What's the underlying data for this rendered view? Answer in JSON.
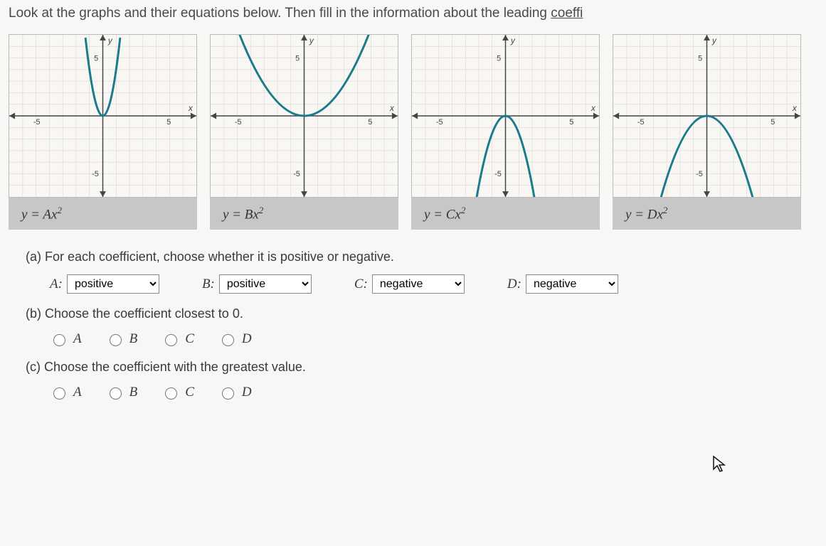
{
  "instruction": {
    "text": "Look at the graphs and their equations below. Then fill in the information about the leading ",
    "underlined_word": "coeffi"
  },
  "graphs": [
    {
      "equation_lhs": "y = Ax",
      "equation_sup": "2",
      "axis": {
        "xmin": -5,
        "xmax": 5,
        "ymin": -5,
        "ymax": 5,
        "xlabel": "x",
        "ylabel": "y"
      }
    },
    {
      "equation_lhs": "y = Bx",
      "equation_sup": "2",
      "axis": {
        "xmin": -5,
        "xmax": 5,
        "ymin": -5,
        "ymax": 5,
        "xlabel": "x",
        "ylabel": "y"
      }
    },
    {
      "equation_lhs": "y = Cx",
      "equation_sup": "2",
      "axis": {
        "xmin": -5,
        "xmax": 5,
        "ymin": -5,
        "ymax": 5,
        "xlabel": "x",
        "ylabel": "y"
      }
    },
    {
      "equation_lhs": "y = Dx",
      "equation_sup": "2",
      "axis": {
        "xmin": -5,
        "xmax": 5,
        "ymin": -5,
        "ymax": 5,
        "xlabel": "x",
        "ylabel": "y"
      }
    }
  ],
  "chart_data": [
    {
      "type": "line",
      "title": "y = Ax^2",
      "xlabel": "x",
      "ylabel": "y",
      "xlim": [
        -7,
        7
      ],
      "ylim": [
        -7,
        7
      ],
      "series": [
        {
          "name": "A",
          "coefficient_sign": "positive",
          "coefficient_approx": 4,
          "points": [
            [
              -1.3,
              6.76
            ],
            [
              -1.2,
              5.76
            ],
            [
              -1,
              4
            ],
            [
              -0.8,
              2.56
            ],
            [
              -0.6,
              1.44
            ],
            [
              -0.4,
              0.64
            ],
            [
              -0.2,
              0.16
            ],
            [
              0,
              0
            ],
            [
              0.2,
              0.16
            ],
            [
              0.4,
              0.64
            ],
            [
              0.6,
              1.44
            ],
            [
              0.8,
              2.56
            ],
            [
              1,
              4
            ],
            [
              1.2,
              5.76
            ],
            [
              1.3,
              6.76
            ]
          ]
        }
      ]
    },
    {
      "type": "line",
      "title": "y = Bx^2",
      "xlabel": "x",
      "ylabel": "y",
      "xlim": [
        -7,
        7
      ],
      "ylim": [
        -7,
        7
      ],
      "series": [
        {
          "name": "B",
          "coefficient_sign": "positive",
          "coefficient_approx": 0.3,
          "points": [
            [
              -5,
              7.5
            ],
            [
              -4,
              4.8
            ],
            [
              -3,
              2.7
            ],
            [
              -2,
              1.2
            ],
            [
              -1,
              0.3
            ],
            [
              0,
              0
            ],
            [
              1,
              0.3
            ],
            [
              2,
              1.2
            ],
            [
              3,
              2.7
            ],
            [
              4,
              4.8
            ],
            [
              5,
              7.5
            ]
          ]
        }
      ]
    },
    {
      "type": "line",
      "title": "y = Cx^2",
      "xlabel": "x",
      "ylabel": "y",
      "xlim": [
        -7,
        7
      ],
      "ylim": [
        -7,
        7
      ],
      "series": [
        {
          "name": "C",
          "coefficient_sign": "negative",
          "coefficient_approx": -1.5,
          "points": [
            [
              -2.2,
              -7.26
            ],
            [
              -2,
              -6
            ],
            [
              -1.5,
              -3.375
            ],
            [
              -1,
              -1.5
            ],
            [
              -0.5,
              -0.375
            ],
            [
              0,
              0
            ],
            [
              0.5,
              -0.375
            ],
            [
              1,
              -1.5
            ],
            [
              1.5,
              -3.375
            ],
            [
              2,
              -6
            ],
            [
              2.2,
              -7.26
            ]
          ]
        }
      ]
    },
    {
      "type": "line",
      "title": "y = Dx^2",
      "xlabel": "x",
      "ylabel": "y",
      "xlim": [
        -7,
        7
      ],
      "ylim": [
        -7,
        7
      ],
      "series": [
        {
          "name": "D",
          "coefficient_sign": "negative",
          "coefficient_approx": -0.6,
          "points": [
            [
              -3.5,
              -7.35
            ],
            [
              -3,
              -5.4
            ],
            [
              -2.5,
              -3.75
            ],
            [
              -2,
              -2.4
            ],
            [
              -1.5,
              -1.35
            ],
            [
              -1,
              -0.6
            ],
            [
              -0.5,
              -0.15
            ],
            [
              0,
              0
            ],
            [
              0.5,
              -0.15
            ],
            [
              1,
              -0.6
            ],
            [
              1.5,
              -1.35
            ],
            [
              2,
              -2.4
            ],
            [
              2.5,
              -3.75
            ],
            [
              3,
              -5.4
            ],
            [
              3.5,
              -7.35
            ]
          ]
        }
      ]
    }
  ],
  "part_a": {
    "prompt": "(a)  For each coefficient, choose whether it is positive or negative.",
    "options": [
      "positive",
      "negative"
    ],
    "items": [
      {
        "label": "A:",
        "selected": "positive"
      },
      {
        "label": "B:",
        "selected": "positive"
      },
      {
        "label": "C:",
        "selected": "negative"
      },
      {
        "label": "D:",
        "selected": "negative"
      }
    ]
  },
  "part_b": {
    "prompt": "(b)  Choose the coefficient closest to 0.",
    "choices": [
      "A",
      "B",
      "C",
      "D"
    ]
  },
  "part_c": {
    "prompt": "(c)  Choose the coefficient with the greatest value.",
    "choices": [
      "A",
      "B",
      "C",
      "D"
    ]
  }
}
